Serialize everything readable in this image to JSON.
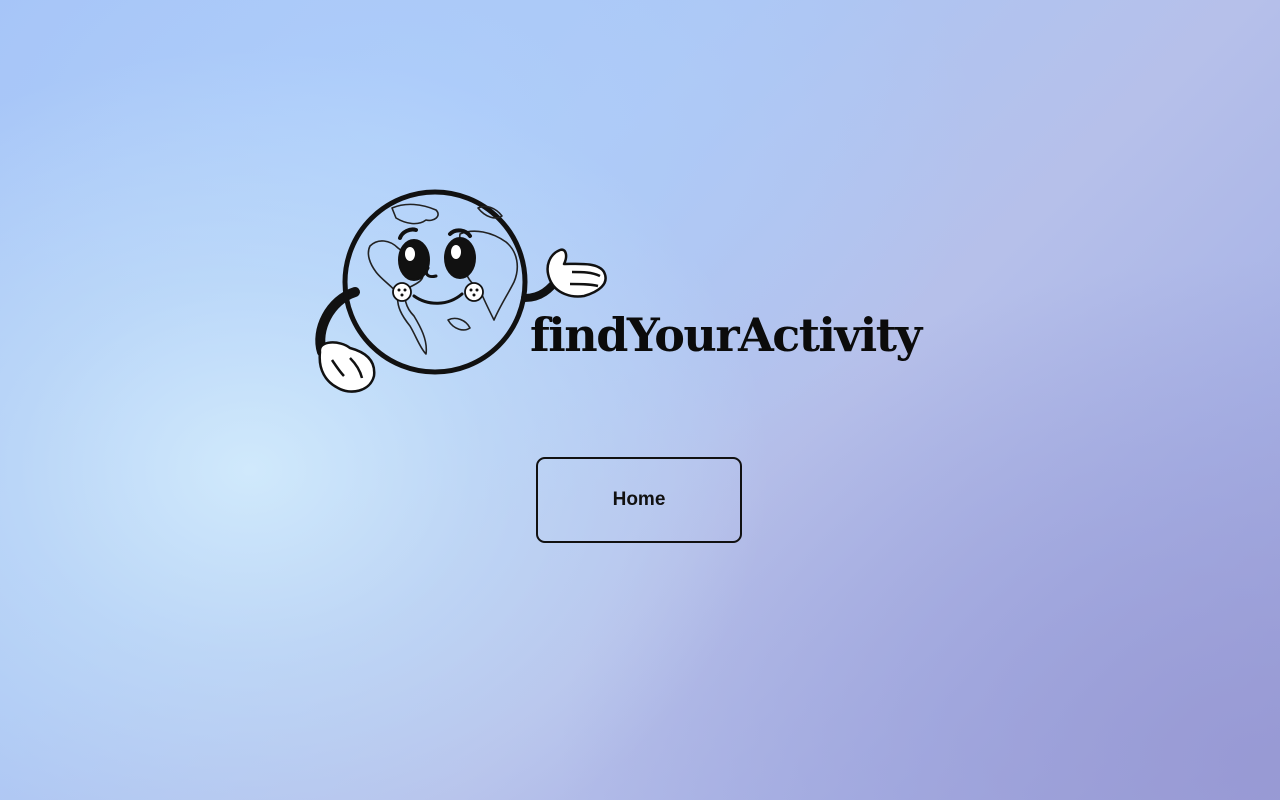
{
  "brand": {
    "name": "findYourActivity",
    "mascot_icon": "earth-mascot-icon"
  },
  "nav": {
    "home_label": "Home"
  },
  "colors": {
    "text": "#111111",
    "background_light": "#cfe6fb",
    "background_dark": "#9fa6dc"
  }
}
